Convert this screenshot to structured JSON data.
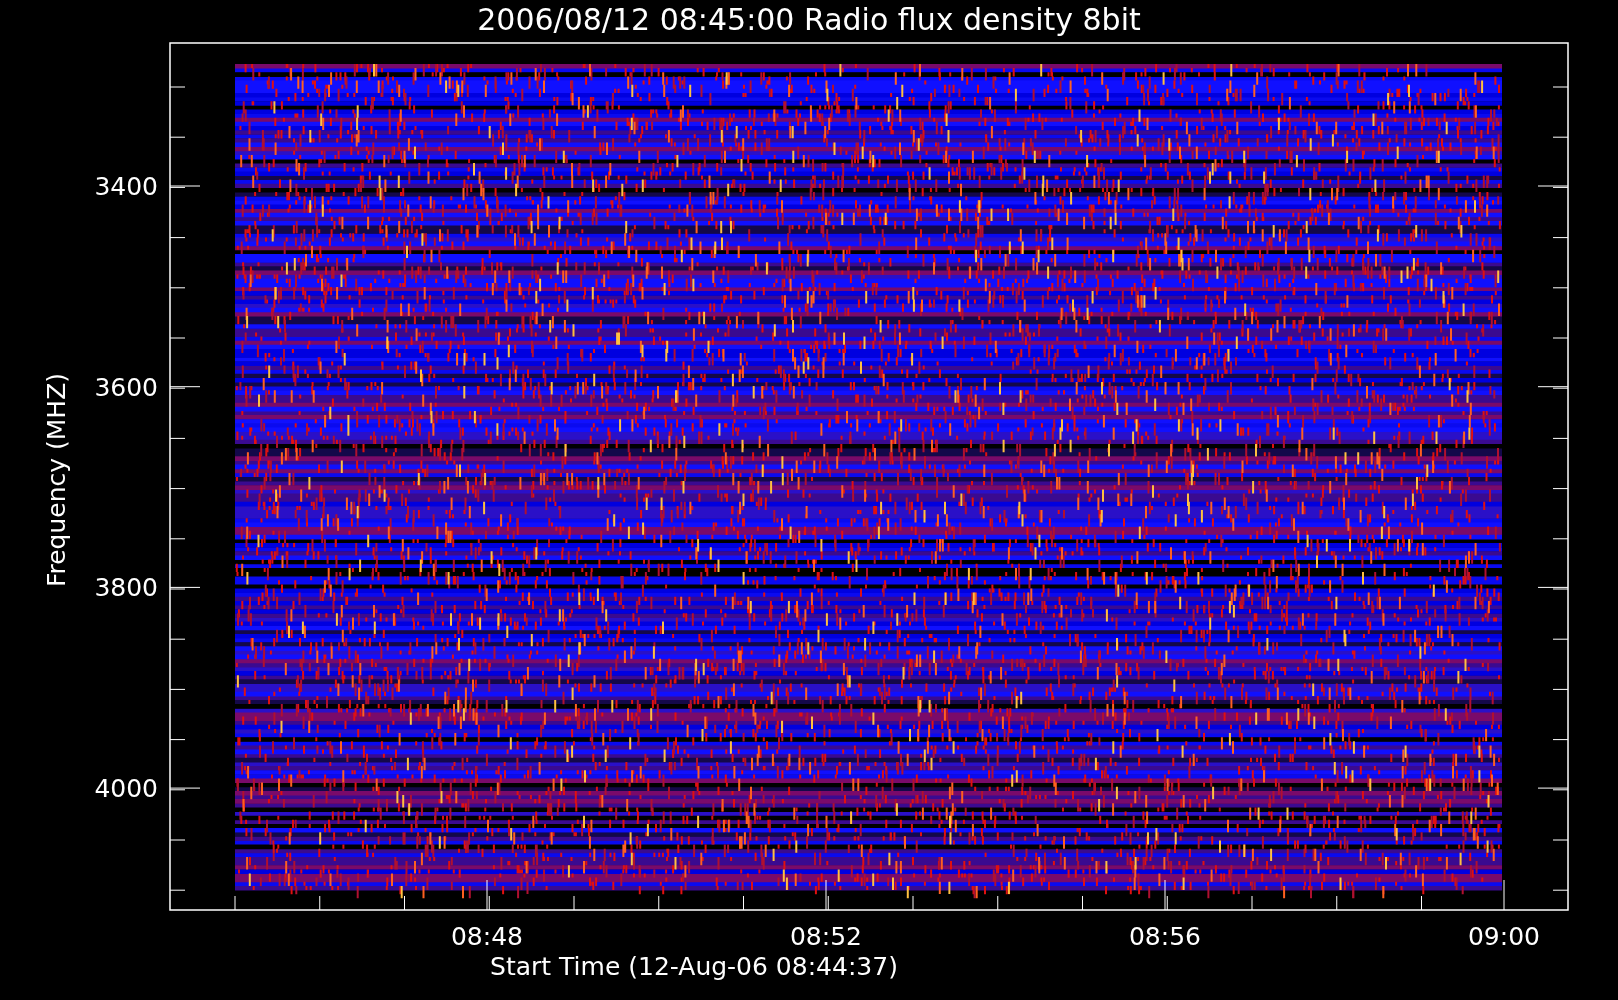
{
  "plot": {
    "title": "2006/08/12 08:45:00 Radio flux density 8bit",
    "ylabel": "Frequency (MHZ)",
    "xlabel": "Start Time (12-Aug-06 08:44:37)",
    "yticks": [
      "3400",
      "3600",
      "3800",
      "4000"
    ],
    "xticks": [
      "08:48",
      "08:52",
      "08:56",
      "09:00"
    ]
  }
}
